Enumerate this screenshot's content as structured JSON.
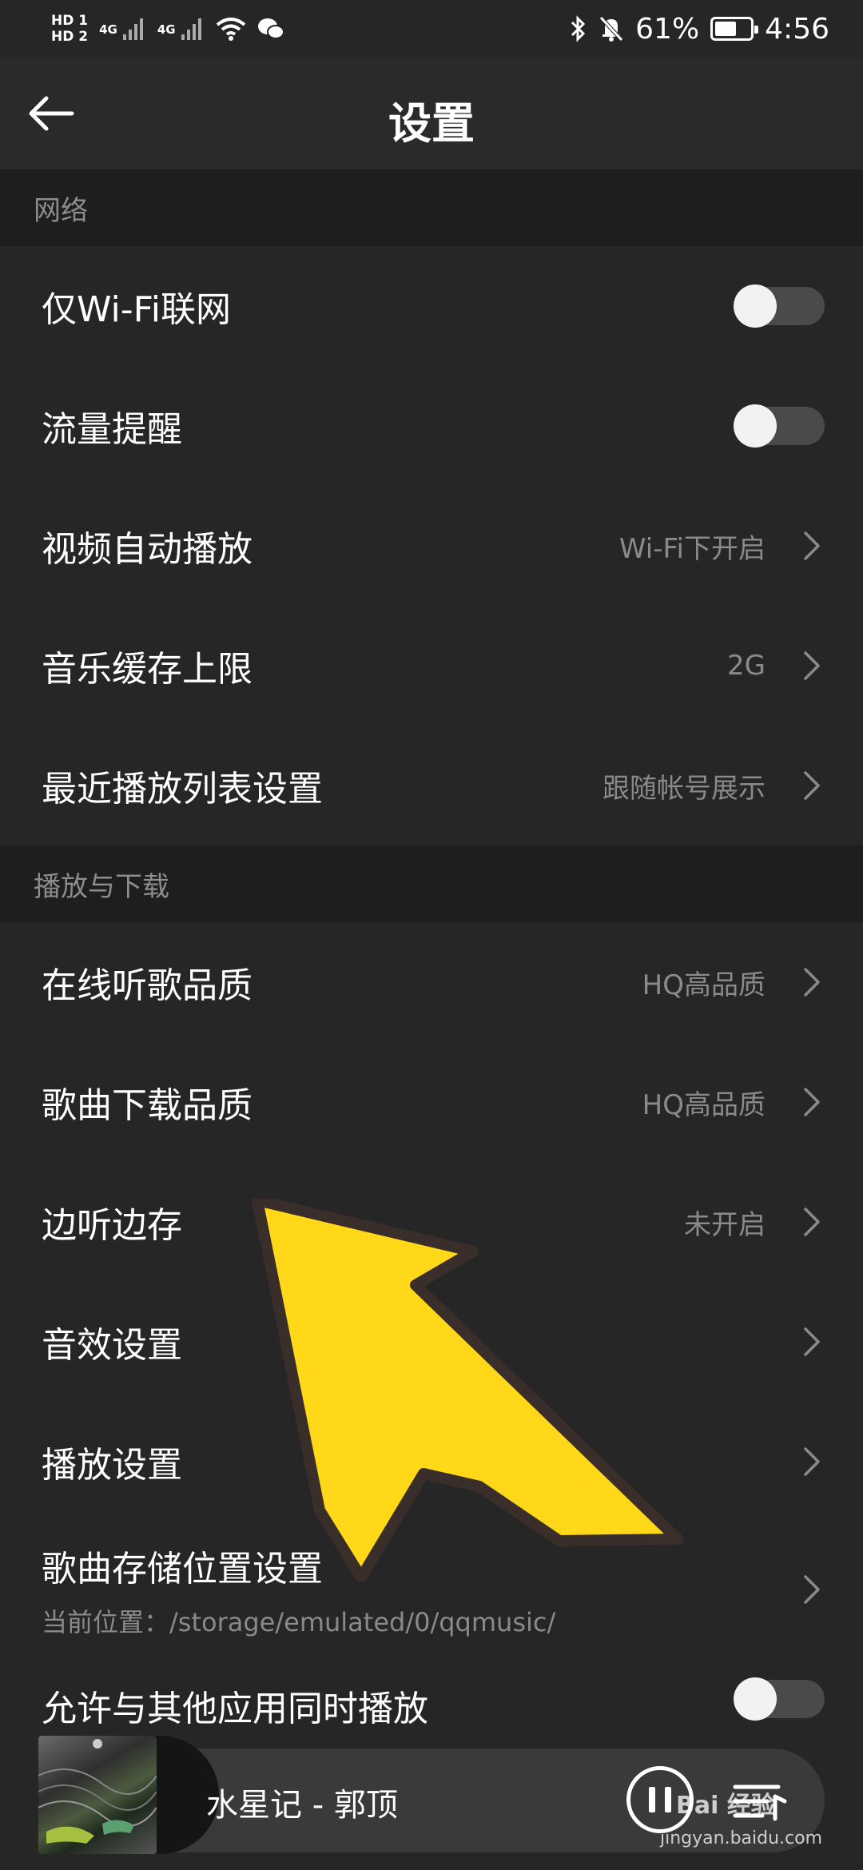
{
  "status_bar": {
    "hd1": "HD 1",
    "hd2": "HD 2",
    "net1": "4G",
    "net2": "4G",
    "battery_percent": "61%",
    "battery_level": 0.61,
    "time": "4:56",
    "icons": [
      "signal-icon",
      "wifi-icon",
      "wechat-icon",
      "bluetooth-icon",
      "mute-bell-icon",
      "battery-icon"
    ]
  },
  "header": {
    "title": "设置",
    "back_icon": "back-arrow-icon"
  },
  "sections": {
    "network": {
      "title": "网络",
      "rows": {
        "wifi_only": {
          "label": "仅Wi-Fi联网",
          "toggle": false
        },
        "data_alert": {
          "label": "流量提醒",
          "toggle": false
        },
        "video_autoplay": {
          "label": "视频自动播放",
          "value": "Wi-Fi下开启"
        },
        "music_cache": {
          "label": "音乐缓存上限",
          "value": "2G"
        },
        "recent_playlist": {
          "label": "最近播放列表设置",
          "value": "跟随帐号展示"
        }
      }
    },
    "playback": {
      "title": "播放与下载",
      "rows": {
        "online_quality": {
          "label": "在线听歌品质",
          "value": "HQ高品质"
        },
        "download_quality": {
          "label": "歌曲下载品质",
          "value": "HQ高品质"
        },
        "cache_while_listen": {
          "label": "边听边存",
          "value": "未开启"
        },
        "sound_effects": {
          "label": "音效设置"
        },
        "playback_settings": {
          "label": "播放设置"
        },
        "storage_location": {
          "label": "歌曲存储位置设置",
          "sub": "当前位置：/storage/emulated/0/qqmusic/"
        },
        "allow_concurrent": {
          "label": "允许与其他应用同时播放",
          "toggle": false
        }
      }
    }
  },
  "mini_player": {
    "song": "水星记 - 郭顶"
  },
  "watermark": {
    "brand": "Bai 经验",
    "url": "jingyan.baidu.com"
  },
  "colors": {
    "background": "#262626",
    "section_bg": "#1e1e1e",
    "arrow": "#ffd81a"
  }
}
